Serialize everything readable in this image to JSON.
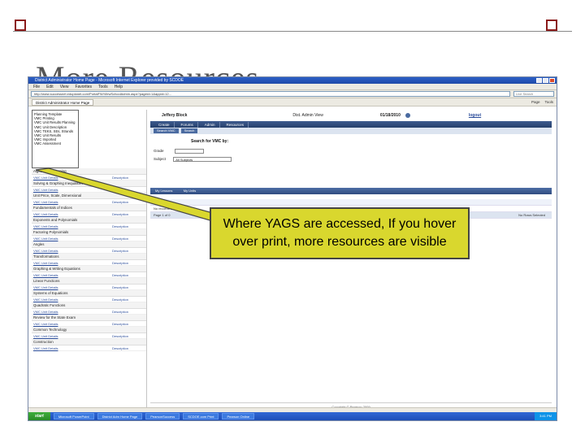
{
  "slide": {
    "title": "More Resources"
  },
  "browser": {
    "window_title": "District Administrator Home Page - Microsoft Internet Explorer provided by SCDOE",
    "menu": [
      "File",
      "Edit",
      "View",
      "Favorites",
      "Tools",
      "Help"
    ],
    "address": "http://www.successnet.eduplanet.com/PortalFW/ViewSchoolAdmin.aspx?pageid=1&appid=12...",
    "search_placeholder": "Live Search",
    "tab_label": "District Administrator Home Page",
    "tab_tools": [
      "Page",
      "Tools"
    ]
  },
  "popup": {
    "items": [
      "Planning Template",
      "VMC Printing",
      "VMC Unit Results Planning",
      "VMC Unit Description",
      "VMC TEKS, SEs, Strands",
      "VMC Unit Results",
      "VMC Imported",
      "VMC Assessment"
    ]
  },
  "left_list": [
    {
      "title": "Algebraic Reasoning",
      "left": "VMC Unit Details",
      "right": "Description"
    },
    {
      "title": "Solving & Graphing Inequalities",
      "left": "VMC Unit Details",
      "right": "Description"
    },
    {
      "title": "Unit Price, Scale, Dimensional",
      "left": "VMC Unit Details",
      "right": "Description"
    },
    {
      "title": "Fundamentals of Indices",
      "left": "VMC Unit Details",
      "right": "Description"
    },
    {
      "title": "Exponents and Polynomials",
      "left": "VMC Unit Details",
      "right": "Description"
    },
    {
      "title": "Factoring Polynomials",
      "left": "VMC Unit Details",
      "right": "Description"
    },
    {
      "title": "Angles",
      "left": "VMC Unit Details",
      "right": "Description"
    },
    {
      "title": "Transformations",
      "left": "VMC Unit Details",
      "right": "Description"
    },
    {
      "title": "Graphing & Writing Equations",
      "left": "VMC Unit Details",
      "right": "Description"
    },
    {
      "title": "Linear Functions",
      "left": "VMC Unit Details",
      "right": "Description"
    },
    {
      "title": "Systems of Equations",
      "left": "VMC Unit Details",
      "right": "Description"
    },
    {
      "title": "Quadratic Functions",
      "left": "VMC Unit Details",
      "right": "Description"
    },
    {
      "title": "Review for the State Exam",
      "left": "VMC Unit Details",
      "right": "Description"
    },
    {
      "title": "Common Technology",
      "left": "VMC Unit Details",
      "right": "Description"
    },
    {
      "title": "Construction",
      "left": "VMC Unit Details",
      "right": "Description"
    }
  ],
  "main": {
    "user_name": "Jeffery Block",
    "view_label": "Dist. Admin View",
    "date": "01/18/2010",
    "logout": "logout",
    "nav": [
      "Create",
      "Forums",
      "Admin",
      "Resources"
    ],
    "sub": [
      "Search VMC",
      "Search"
    ],
    "search_heading": "Search for VMC by:",
    "grade_label": "Grade",
    "subject_label": "Subject",
    "subject_value": "All Subjects",
    "grid_headers": [
      "My Lessons",
      "My Units"
    ],
    "grid_title": "Title",
    "grid_empty": "No records to display",
    "grid_page": "Page 1 of 0",
    "grid_right": "No Rows Selected",
    "copyright": "Copyright © Pearson 2009"
  },
  "taskbar": {
    "start": "start",
    "buttons": [
      "Microsoft PowerPoint",
      "District Adm Home Page",
      "PearsonSuccess",
      "SCDOE.com Print",
      "Pearson Online"
    ],
    "tray": "3:41 PM"
  },
  "callout": {
    "text": "Where YAGS are accessed, If you hover over print, more resources are visible"
  }
}
